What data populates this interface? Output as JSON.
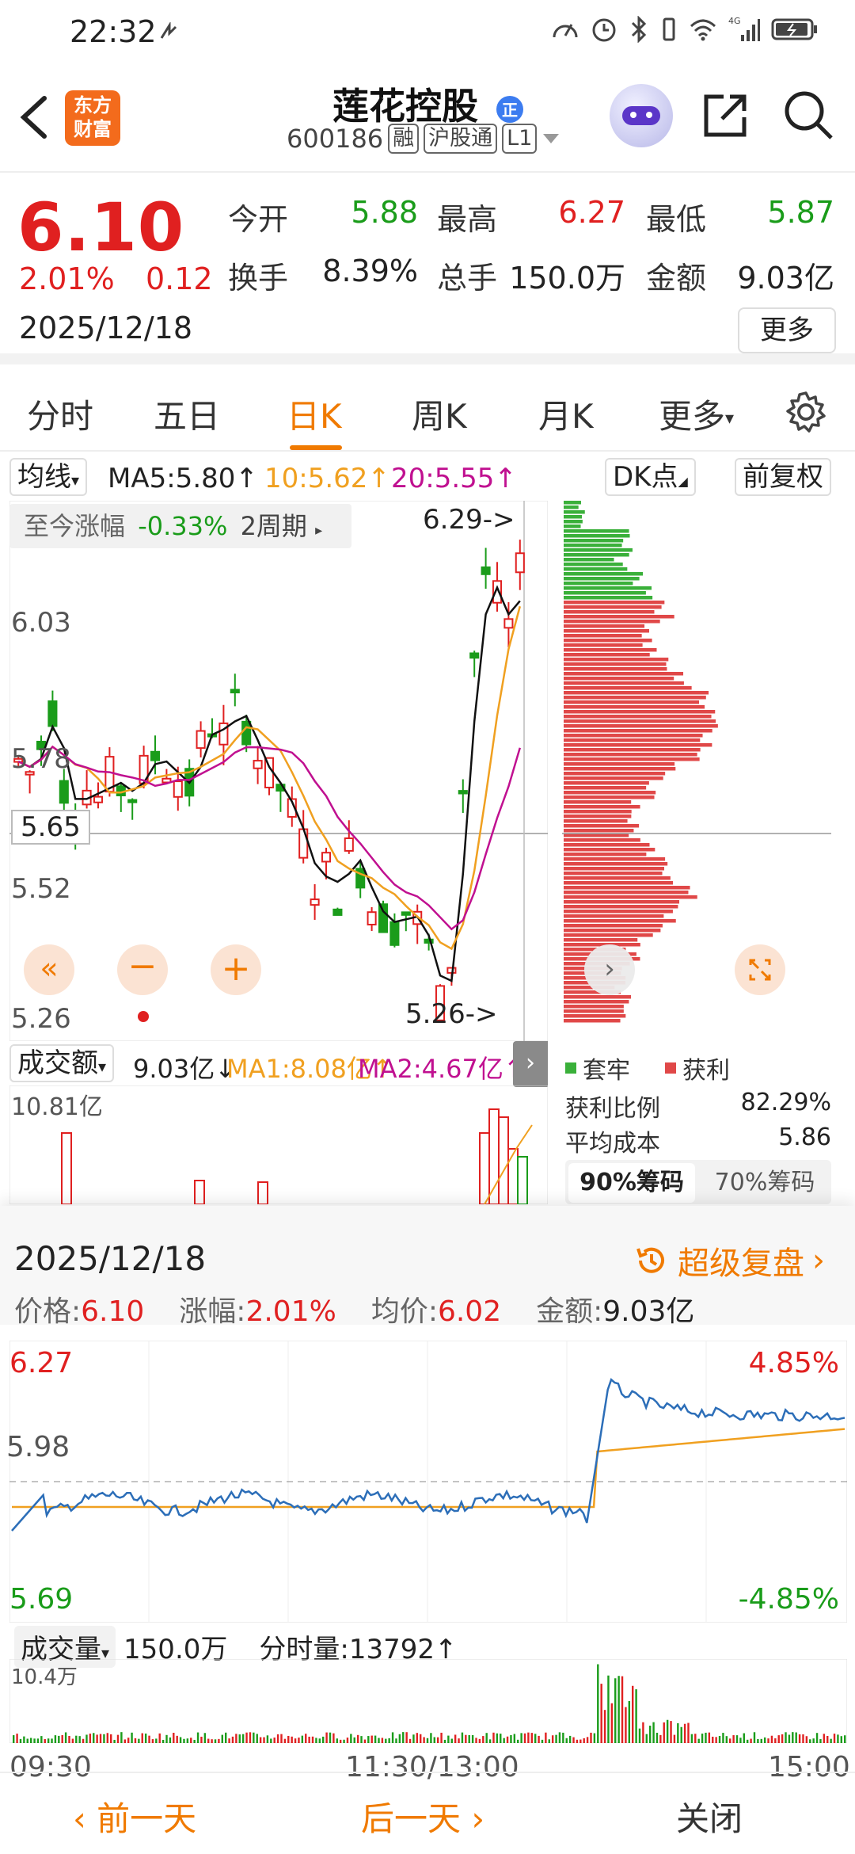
{
  "status": {
    "time": "22:32"
  },
  "header": {
    "logo_text_1": "东方",
    "logo_text_2": "财富",
    "stock_name": "莲花控股",
    "code": "600186",
    "tags": [
      "融",
      "沪股通",
      "L1"
    ]
  },
  "quote": {
    "price": "6.10",
    "pct": "2.01%",
    "change": "0.12",
    "date": "2025/12/18",
    "open_label": "今开",
    "open": "5.88",
    "high_label": "最高",
    "high": "6.27",
    "low_label": "最低",
    "low": "5.87",
    "turnover_label": "换手",
    "turnover": "8.39%",
    "volume_label": "总手",
    "volume": "150.0万",
    "amount_label": "金额",
    "amount": "9.03亿",
    "more_label": "更多"
  },
  "tabs": [
    "分时",
    "五日",
    "日K",
    "周K",
    "月K",
    "更多"
  ],
  "ma": {
    "selector": "均线",
    "ma5": "MA5:5.80",
    "ma10": "10:5.62",
    "ma20": "20:5.55",
    "dk": "DK点",
    "adjust": "前复权"
  },
  "kchart": {
    "range_label": "至今涨幅",
    "range_value": "-0.33%",
    "range_period": "2周期",
    "y_labels": [
      "6.03",
      "5.78",
      "5.65",
      "5.52",
      "5.26"
    ],
    "max_label": "6.29->",
    "min_label": "5.26->",
    "colors": {
      "up": "#e02020",
      "down": "#1a9c1a",
      "ma5": "#111111",
      "ma10": "#f0a020",
      "ma20": "#c01090"
    }
  },
  "volume_bar": {
    "selector": "成交额",
    "value": "9.03亿",
    "ma1": "MA1:8.08亿",
    "ma2": "MA2:4.67亿",
    "top_label": "10.81亿"
  },
  "chips": {
    "legend_trapped": "套牢",
    "legend_profit": "获利",
    "profit_ratio_label": "获利比例",
    "profit_ratio": "82.29%",
    "avg_cost_label": "平均成本",
    "avg_cost": "5.86",
    "tab_90": "90%筹码",
    "tab_70": "70%筹码"
  },
  "sheet": {
    "date": "2025/12/18",
    "super_label": "超级复盘",
    "price_label": "价格:",
    "price": "6.10",
    "pct_label": "涨幅:",
    "pct": "2.01%",
    "avg_label": "均价:",
    "avg": "6.02",
    "amount_label": "金额:",
    "amount": "9.03亿",
    "intraday_high": "6.27",
    "intraday_mid": "5.98",
    "intraday_low": "5.69",
    "pct_high": "4.85%",
    "pct_low": "-4.85%",
    "vol_selector": "成交量",
    "vol_total": "150.0万",
    "vol_tick": "分时量:13792",
    "vol_top": "10.4万",
    "time_start": "09:30",
    "time_mid": "11:30/13:00",
    "time_end": "15:00"
  },
  "footer": {
    "prev": "前一天",
    "next": "后一天",
    "close": "关闭"
  }
}
